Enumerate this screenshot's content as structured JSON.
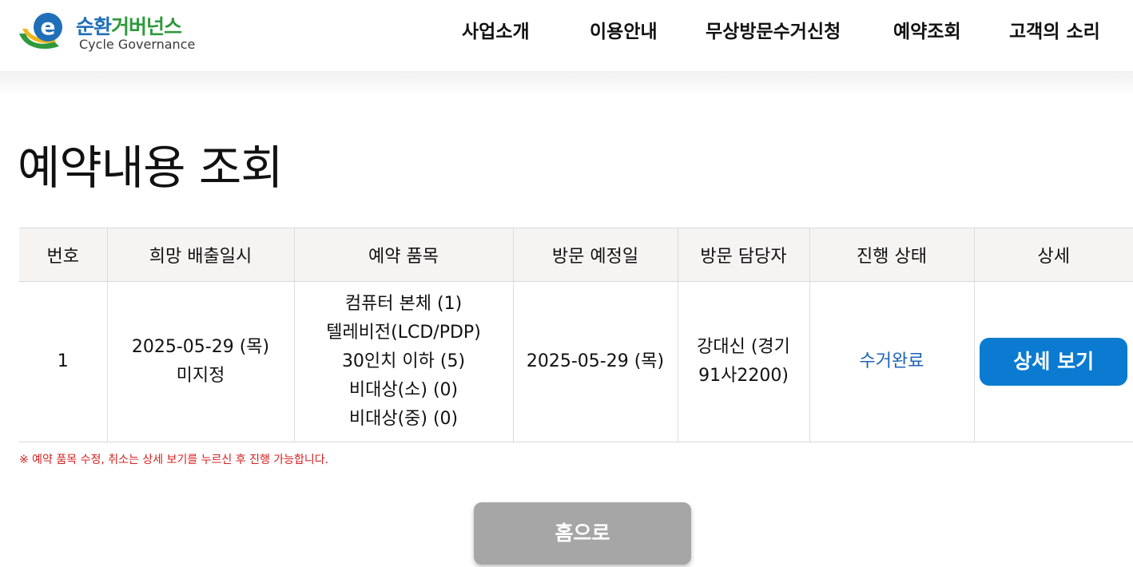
{
  "logo": {
    "ko_blue": "순환",
    "ko_green": "거버넌스",
    "en": "Cycle Governance",
    "letter": "e"
  },
  "nav": [
    {
      "label": "사업소개"
    },
    {
      "label": "이용안내"
    },
    {
      "label": "무상방문수거신청"
    },
    {
      "label": "예약조회"
    },
    {
      "label": "고객의 소리"
    }
  ],
  "page": {
    "title": "예약내용 조회"
  },
  "table": {
    "headers": [
      "번호",
      "희망 배출일시",
      "예약 품목",
      "방문 예정일",
      "방문 담당자",
      "진행 상태",
      "상세"
    ],
    "rows": [
      {
        "no": "1",
        "wish_date": "2025-05-29 (목)",
        "wish_time": "미지정",
        "items": [
          "컴퓨터 본체 (1)",
          "텔레비전(LCD/PDP)",
          "30인치 이하 (5)",
          "비대상(소) (0)",
          "비대상(중) (0)"
        ],
        "visit_date": "2025-05-29 (목)",
        "staff_line1": "강대신 (경기",
        "staff_line2": "91사2200)",
        "status": "수거완료",
        "detail_label": "상세 보기"
      }
    ]
  },
  "note": "※ 예약 품목 수정, 취소는 상세 보기를 누르신 후 진행 가능합니다.",
  "home_button": "홈으로",
  "colors": {
    "brand_blue": "#1f6fb8",
    "brand_green": "#2f9a3c",
    "button_blue": "#0a7bd1",
    "status_blue": "#1e63b5",
    "note_red": "#d62020",
    "home_gray": "#a6a6a6"
  }
}
